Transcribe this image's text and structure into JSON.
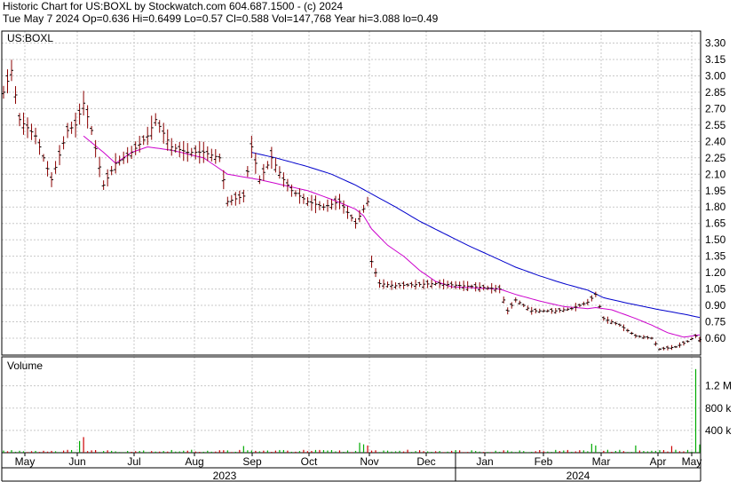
{
  "header": {
    "line1": "Historic Chart for US:BOXL by Stockwatch.com 604.687.1500 - (c) 2024",
    "line2": "Tue May  7 2024  Op=0.636  Hi=0.6499  Lo=0.57  Cl=0.588  Vol=147,768  Year hi=3.088  lo=0.49"
  },
  "chart_data": [
    {
      "type": "line",
      "title": "US:BOXL",
      "yticks": [
        "3.30",
        "3.15",
        "3.00",
        "2.85",
        "2.70",
        "2.55",
        "2.40",
        "2.25",
        "2.10",
        "1.95",
        "1.80",
        "1.65",
        "1.50",
        "1.35",
        "1.20",
        "1.05",
        "0.90",
        "0.75",
        "0.60"
      ],
      "ylim": [
        0.49,
        3.35
      ],
      "grid": true,
      "colors": {
        "price": "#8b0000",
        "tick": "#000000",
        "ma_short": "#cc00cc",
        "ma_long": "#0000cc"
      },
      "x_months": [
        "May",
        "Jun",
        "Jul",
        "Aug",
        "Sep",
        "Oct",
        "Nov",
        "Dec",
        "Jan",
        "Feb",
        "Mar",
        "Apr",
        "May"
      ],
      "x_years": [
        "2023",
        "2024"
      ],
      "price_anchors": [
        [
          0,
          2.85
        ],
        [
          2,
          3.05
        ],
        [
          4,
          2.6
        ],
        [
          8,
          2.45
        ],
        [
          12,
          2.05
        ],
        [
          16,
          2.5
        ],
        [
          18,
          2.55
        ],
        [
          20,
          2.75
        ],
        [
          22,
          2.5
        ],
        [
          25,
          2.0
        ],
        [
          28,
          2.2
        ],
        [
          32,
          2.3
        ],
        [
          36,
          2.45
        ],
        [
          38,
          2.6
        ],
        [
          42,
          2.35
        ],
        [
          46,
          2.3
        ],
        [
          50,
          2.3
        ],
        [
          54,
          2.25
        ],
        [
          56,
          1.85
        ],
        [
          60,
          1.9
        ],
        [
          62,
          2.35
        ],
        [
          64,
          2.05
        ],
        [
          67,
          2.25
        ],
        [
          70,
          2.05
        ],
        [
          72,
          1.95
        ],
        [
          76,
          1.85
        ],
        [
          80,
          1.8
        ],
        [
          84,
          1.85
        ],
        [
          88,
          1.65
        ],
        [
          91,
          1.85
        ],
        [
          92,
          1.3
        ],
        [
          94,
          1.1
        ],
        [
          98,
          1.08
        ],
        [
          108,
          1.1
        ],
        [
          118,
          1.07
        ],
        [
          124,
          1.05
        ],
        [
          126,
          0.85
        ],
        [
          128,
          0.95
        ],
        [
          132,
          0.85
        ],
        [
          138,
          0.85
        ],
        [
          142,
          0.87
        ],
        [
          146,
          0.93
        ],
        [
          148,
          1.0
        ],
        [
          150,
          0.78
        ],
        [
          154,
          0.72
        ],
        [
          158,
          0.62
        ],
        [
          162,
          0.6
        ],
        [
          164,
          0.5
        ],
        [
          168,
          0.52
        ],
        [
          171,
          0.57
        ],
        [
          173,
          0.62
        ],
        [
          174,
          0.588
        ]
      ],
      "ma_short_anchors": [
        [
          20,
          2.45
        ],
        [
          25,
          2.3
        ],
        [
          28,
          2.2
        ],
        [
          32,
          2.3
        ],
        [
          36,
          2.35
        ],
        [
          42,
          2.32
        ],
        [
          50,
          2.25
        ],
        [
          56,
          2.1
        ],
        [
          64,
          2.05
        ],
        [
          70,
          2.0
        ],
        [
          76,
          1.95
        ],
        [
          82,
          1.87
        ],
        [
          88,
          1.78
        ],
        [
          90,
          1.72
        ],
        [
          92,
          1.6
        ],
        [
          96,
          1.45
        ],
        [
          100,
          1.35
        ],
        [
          104,
          1.22
        ],
        [
          108,
          1.12
        ],
        [
          112,
          1.07
        ],
        [
          118,
          1.06
        ],
        [
          124,
          1.05
        ],
        [
          128,
          1.0
        ],
        [
          134,
          0.94
        ],
        [
          140,
          0.89
        ],
        [
          146,
          0.87
        ],
        [
          148,
          0.88
        ],
        [
          152,
          0.86
        ],
        [
          158,
          0.78
        ],
        [
          162,
          0.72
        ],
        [
          166,
          0.65
        ],
        [
          170,
          0.61
        ],
        [
          174,
          0.63
        ]
      ],
      "ma_long_anchors": [
        [
          62,
          2.3
        ],
        [
          68,
          2.25
        ],
        [
          76,
          2.17
        ],
        [
          82,
          2.1
        ],
        [
          88,
          2.0
        ],
        [
          92,
          1.92
        ],
        [
          98,
          1.8
        ],
        [
          104,
          1.67
        ],
        [
          110,
          1.56
        ],
        [
          116,
          1.45
        ],
        [
          122,
          1.35
        ],
        [
          128,
          1.25
        ],
        [
          134,
          1.17
        ],
        [
          140,
          1.1
        ],
        [
          146,
          1.04
        ],
        [
          150,
          0.97
        ],
        [
          156,
          0.92
        ],
        [
          164,
          0.86
        ],
        [
          170,
          0.82
        ],
        [
          174,
          0.79
        ]
      ]
    },
    {
      "type": "bar",
      "title": "Volume",
      "yticks": [
        "1.2 M",
        "800 k",
        "400 k"
      ],
      "ylim": [
        0,
        1600000
      ],
      "colors": {
        "up": "#00aa00",
        "down": "#cc0000"
      },
      "volume_baseline": 20000,
      "volume_spikes": [
        [
          19,
          210000
        ],
        [
          20,
          280000
        ],
        [
          60,
          120000
        ],
        [
          89,
          180000
        ],
        [
          90,
          150000
        ],
        [
          91,
          130000
        ],
        [
          147,
          160000
        ],
        [
          148,
          130000
        ],
        [
          158,
          130000
        ],
        [
          167,
          120000
        ],
        [
          173,
          1500000
        ],
        [
          174,
          147768
        ]
      ]
    }
  ]
}
